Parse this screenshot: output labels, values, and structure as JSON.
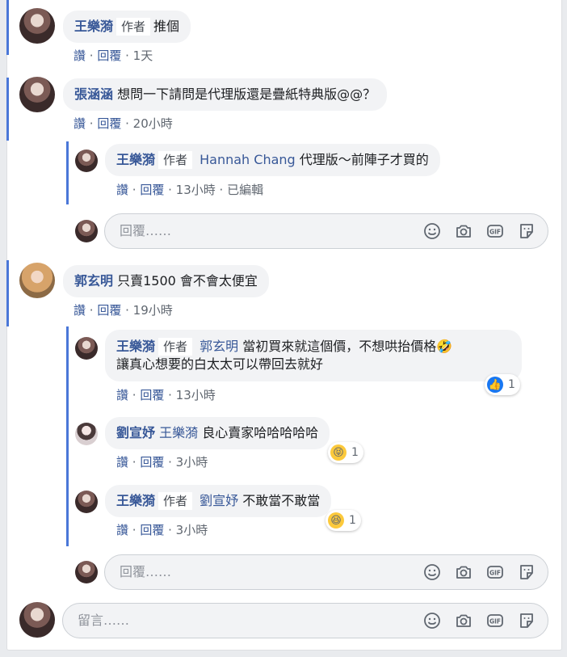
{
  "actions": {
    "like": "讚",
    "reply": "回覆",
    "dot": " · "
  },
  "author_badge": "作者",
  "comments": [
    {
      "name": "王樂漪",
      "text": "推個",
      "time": "1天"
    },
    {
      "name": "張涵涵",
      "text": "想問一下請問是代理版還是疊紙特典版@@？",
      "time": "20小時"
    },
    {
      "name": "王樂漪",
      "tag": "Hannah Chang",
      "text": "代理版～前陣子才買的",
      "time": "13小時",
      "edited": "已編輯"
    },
    {
      "name": "郭玄明",
      "text": "只賣1500 會不會太便宜",
      "time": "19小時"
    },
    {
      "name": "王樂漪",
      "tag": "郭玄明",
      "text_line1": "當初買來就這個價，不想哄抬價格🤣",
      "text_line2": "讓真心想要的白太太可以帶回去就好",
      "time": "13小時",
      "reaction_count": "1"
    },
    {
      "name": "劉宣妤",
      "tag": "王樂漪",
      "text": "良心賣家哈哈哈哈哈",
      "time": "3小時",
      "reaction_count": "1"
    },
    {
      "name": "王樂漪",
      "tag": "劉宣妤",
      "text": "不敢當不敢當",
      "time": "3小時",
      "reaction_count": "1"
    }
  ],
  "reply_placeholder": "回覆……",
  "comment_placeholder": "留言……",
  "icons": [
    "emoji-icon",
    "camera-icon",
    "gif-icon",
    "sticker-icon"
  ],
  "colors": {
    "link": "#385898",
    "thread_line": "#4a77d8",
    "bubble": "#f2f3f5",
    "like": "#1877f2"
  }
}
